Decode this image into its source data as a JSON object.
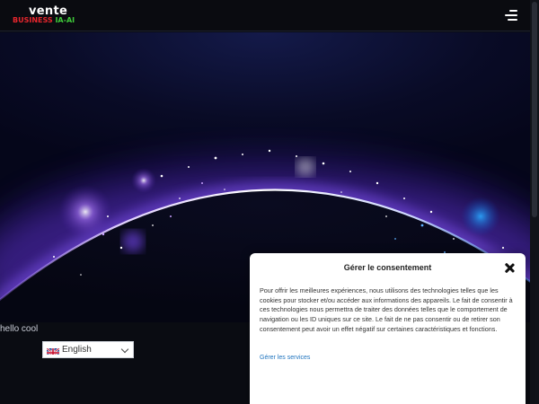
{
  "header": {
    "logo_top": "vente",
    "logo_bottom_red": "BUSINESS",
    "logo_bottom_green": "IA-AI",
    "menu_icon": "hamburger-menu-icon"
  },
  "main": {
    "hello_text": "hello cool",
    "language": {
      "selected": "English",
      "flag_icon": "uk-flag-icon"
    }
  },
  "consent": {
    "title": "Gérer le consentement",
    "body": "Pour offrir les meilleures expériences, nous utilisons des technologies telles que les cookies pour stocker et/ou accéder aux informations des appareils. Le fait de consentir à ces technologies nous permettra de traiter des données telles que le comportement de navigation ou les ID uniques sur ce site. Le fait de ne pas consentir ou de retirer son consentement peut avoir un effet négatif sur certaines caractéristiques et fonctions.",
    "link": "Gérer les services",
    "close_icon": "close-icon"
  },
  "colors": {
    "brand_red": "#e8262d",
    "brand_green": "#3fcb3a",
    "link_blue": "#1e73be"
  }
}
